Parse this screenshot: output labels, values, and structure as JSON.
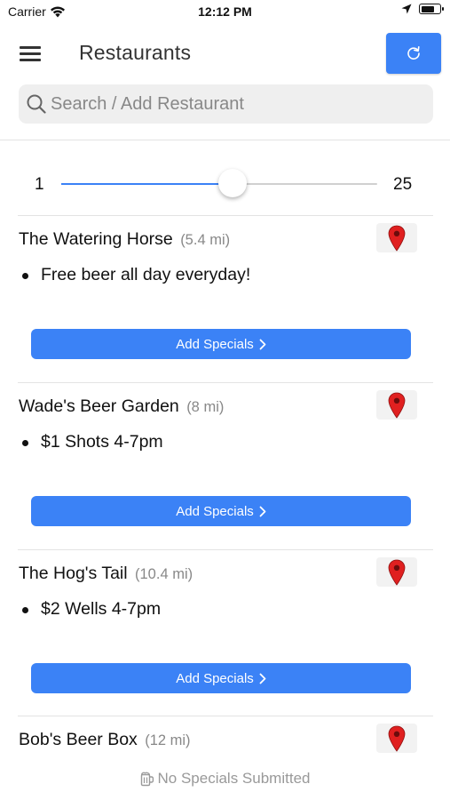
{
  "status_bar": {
    "carrier": "Carrier",
    "time": "12:12 PM",
    "battery_level": 0.7
  },
  "header": {
    "title": "Restaurants"
  },
  "search": {
    "placeholder": "Search / Add Restaurant",
    "value": ""
  },
  "distance_slider": {
    "min_label": "1",
    "max_label": "25",
    "min": 1,
    "max": 25,
    "value": 14
  },
  "restaurants": [
    {
      "name": "The Watering Horse",
      "distance": "(5.4 mi)",
      "specials": [
        "Free beer all day everyday!"
      ],
      "add_specials_label": "Add Specials"
    },
    {
      "name": "Wade's Beer Garden",
      "distance": "(8 mi)",
      "specials": [
        "$1 Shots 4-7pm"
      ],
      "add_specials_label": "Add Specials"
    },
    {
      "name": "The Hog's Tail",
      "distance": "(10.4 mi)",
      "specials": [
        "$2 Wells 4-7pm"
      ],
      "add_specials_label": "Add Specials"
    },
    {
      "name": "Bob's Beer Box",
      "distance": "(12 mi)",
      "specials": [],
      "empty_label": "No Specials Submitted"
    }
  ],
  "colors": {
    "accent": "#3b82f6",
    "map_pin": "#e02020"
  },
  "icons": {
    "menu": "hamburger-icon",
    "refresh": "refresh-icon",
    "search": "search-icon",
    "map": "map-pin-icon",
    "chevron": "chevron-right-icon",
    "empty": "beer-mug-icon"
  }
}
